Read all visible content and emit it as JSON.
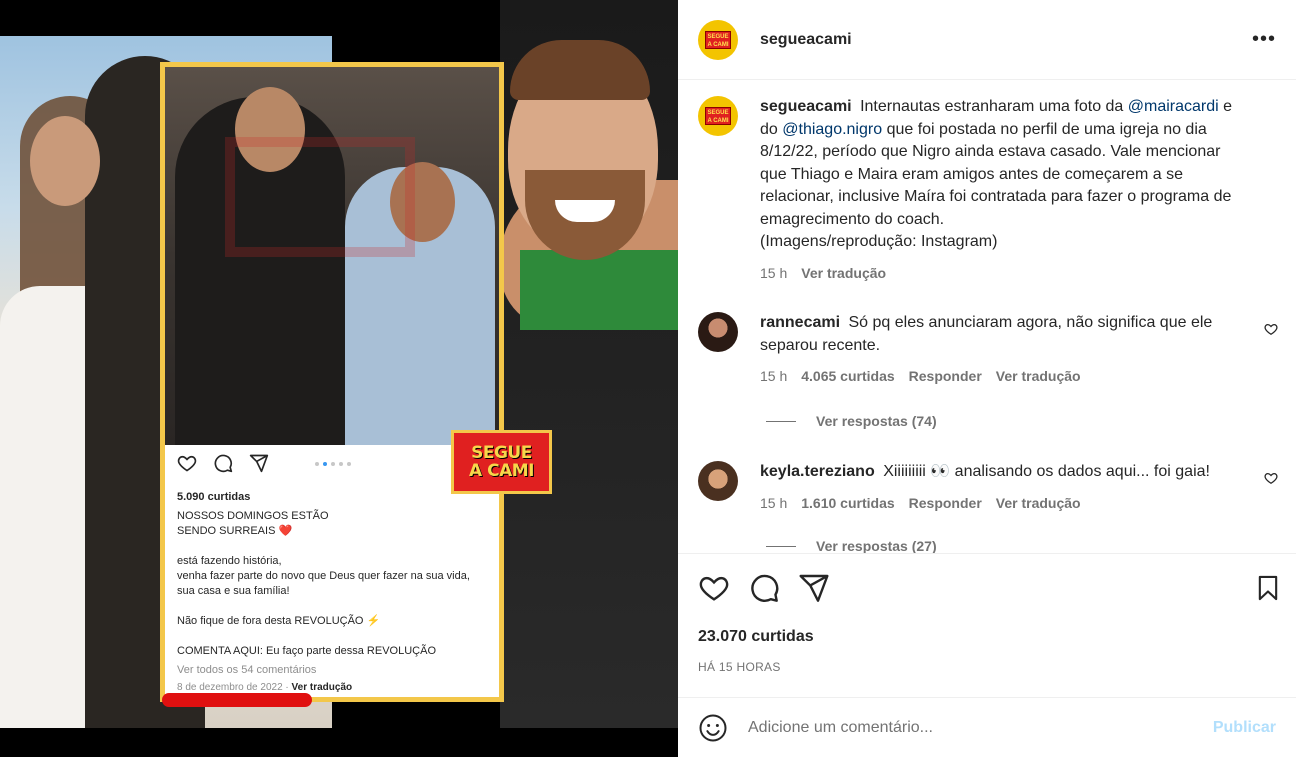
{
  "media": {
    "badge_line1": "SEGUE",
    "badge_line2": "A CAMI",
    "embedded_post": {
      "likes": "5.090 curtidas",
      "caption": "NOSSOS DOMINGOS ESTÃO\nSENDO SURREAIS ❤️\n\nestá fazendo história,\nvenha fazer parte do novo que Deus quer fazer na sua vida, sua casa e sua família!\n\nNão fique de fora desta REVOLUÇÃO ⚡\n\nCOMENTA AQUI: Eu faço parte dessa REVOLUÇÃO",
      "view_all": "Ver todos os 54 comentários",
      "date": "8 de dezembro de 2022",
      "translate": "Ver tradução"
    }
  },
  "header": {
    "username": "segueacami",
    "more": "•••",
    "logo_text": "SEGUE A CAMI"
  },
  "caption": {
    "username": "segueacami",
    "text_1": "Internautas estranharam uma foto da",
    "mention_1": "@mairacardi",
    "text_2": "e do",
    "mention_2": "@thiago.nigro",
    "text_3": "que foi postada no perfil de uma igreja no dia 8/12/22, período que Nigro ainda estava casado. Vale mencionar que Thiago e Maira eram amigos antes de começarem a se relacionar, inclusive Maíra foi contratada para fazer o programa de emagrecimento do coach.",
    "text_4": "(Imagens/reprodução: Instagram)",
    "time": "15 h",
    "translate": "Ver tradução"
  },
  "comments": [
    {
      "username": "rannecami",
      "text": "Só pq eles anunciaram agora, não significa que ele separou recente.",
      "time": "15 h",
      "likes": "4.065 curtidas",
      "reply": "Responder",
      "translate": "Ver tradução",
      "replies": "Ver respostas (74)"
    },
    {
      "username": "keyla.tereziano",
      "text": "Xiiiiiiiii 👀 analisando os dados aqui... foi gaia!",
      "time": "15 h",
      "likes": "1.610 curtidas",
      "reply": "Responder",
      "translate": "Ver tradução",
      "replies": "Ver respostas (27)"
    }
  ],
  "stats": {
    "likes": "23.070 curtidas",
    "time_ago": "HÁ 15 HORAS"
  },
  "add_comment": {
    "placeholder": "Adicione um comentário...",
    "publish": "Publicar"
  },
  "colors": {
    "link": "#00376b",
    "publish_disabled": "#b2dffc",
    "secondary_text": "#737373",
    "brand_yellow": "#f3c400",
    "brand_red": "#e02020"
  }
}
